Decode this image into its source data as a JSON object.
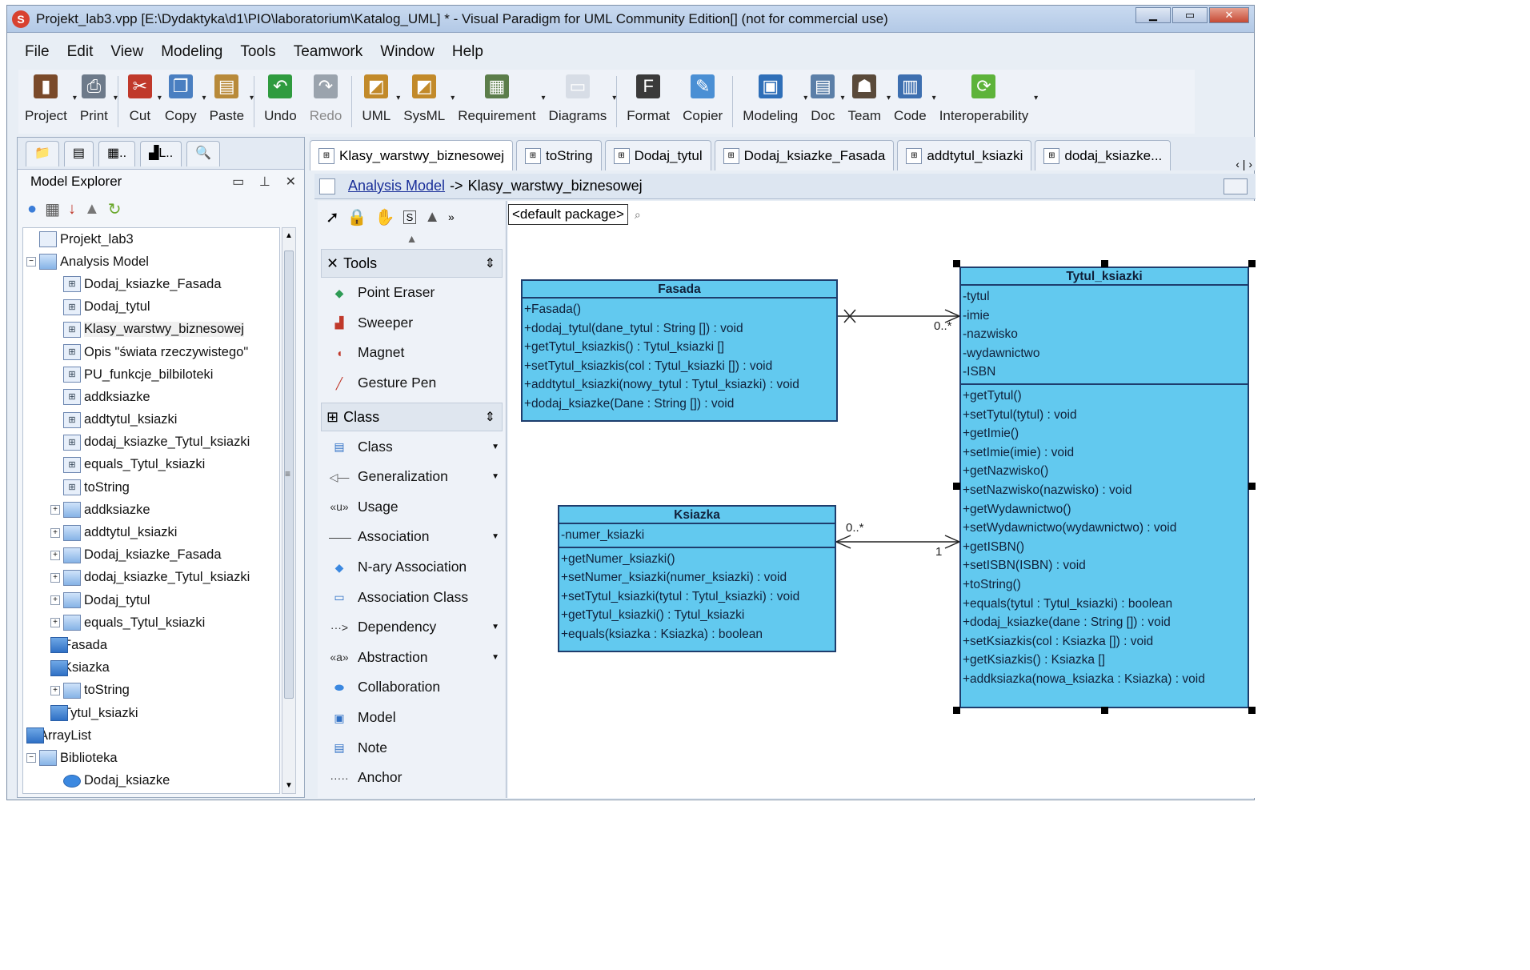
{
  "window": {
    "title": "Projekt_lab3.vpp [E:\\Dydaktyka\\d1\\PIO\\laboratorium\\Katalog_UML] * - Visual Paradigm for UML Community Edition[] (not for commercial use)",
    "minimize": "▁",
    "maximize": "▭",
    "close": "✕"
  },
  "menu": [
    "File",
    "Edit",
    "View",
    "Modeling",
    "Tools",
    "Teamwork",
    "Window",
    "Help"
  ],
  "toolbar": [
    {
      "label": "Project",
      "icon": "project-icon",
      "color": "#7a4a2a"
    },
    {
      "label": "Print",
      "icon": "printer-icon",
      "color": "#6d7a8a"
    },
    {
      "label": "Cut",
      "icon": "scissors-icon",
      "color": "#c0392b"
    },
    {
      "label": "Copy",
      "icon": "copy-icon",
      "color": "#4a7fc1"
    },
    {
      "label": "Paste",
      "icon": "paste-icon",
      "color": "#b88a3a"
    },
    {
      "label": "Undo",
      "icon": "undo-icon",
      "color": "#2f9b3f"
    },
    {
      "label": "Redo",
      "icon": "redo-icon",
      "color": "#9aa3ad",
      "disabled": true
    },
    {
      "label": "UML",
      "icon": "uml-icon",
      "color": "#c28a2a"
    },
    {
      "label": "SysML",
      "icon": "sysml-icon",
      "color": "#c28a2a"
    },
    {
      "label": "Requirement",
      "icon": "requirement-icon",
      "color": "#5b7d4a"
    },
    {
      "label": "Diagrams",
      "icon": "diagrams-icon",
      "color": "#d7dde6"
    },
    {
      "label": "Format",
      "icon": "format-icon",
      "color": "#3a3a3a"
    },
    {
      "label": "Copier",
      "icon": "copier-icon",
      "color": "#4a8fd4"
    },
    {
      "label": "Modeling",
      "icon": "modeling-icon",
      "color": "#2f6fb8"
    },
    {
      "label": "Doc",
      "icon": "doc-icon",
      "color": "#5b7fa8"
    },
    {
      "label": "Team",
      "icon": "team-icon",
      "color": "#5a4a3a"
    },
    {
      "label": "Code",
      "icon": "code-icon",
      "color": "#3d6fb0"
    },
    {
      "label": "Interoperability",
      "icon": "interoperability-icon",
      "color": "#5db33a"
    }
  ],
  "left_panel": {
    "title": "Model Explorer",
    "tabs": [
      "",
      "",
      "..",
      "L..",
      ""
    ],
    "tree": [
      {
        "label": "Projekt_lab3",
        "level": 0,
        "icon": "project-icon",
        "exp": ""
      },
      {
        "label": "Analysis Model",
        "level": 0,
        "icon": "model-icon",
        "exp": "−"
      },
      {
        "label": "Dodaj_ksiazke_Fasada",
        "level": 1,
        "icon": "diagram-icon",
        "exp": ""
      },
      {
        "label": "Dodaj_tytul",
        "level": 1,
        "icon": "diagram-icon",
        "exp": ""
      },
      {
        "label": "Klasy_warstwy_biznesowej",
        "level": 1,
        "icon": "diagram-icon",
        "exp": "",
        "selected": true
      },
      {
        "label": "Opis \"świata rzeczywistego\"",
        "level": 1,
        "icon": "diagram-icon",
        "exp": ""
      },
      {
        "label": "PU_funkcje_bilbiloteki",
        "level": 1,
        "icon": "diagram-icon",
        "exp": ""
      },
      {
        "label": "addksiazke",
        "level": 1,
        "icon": "diagram-icon",
        "exp": ""
      },
      {
        "label": "addtytul_ksiazki",
        "level": 1,
        "icon": "diagram-icon",
        "exp": ""
      },
      {
        "label": "dodaj_ksiazke_Tytul_ksiazki",
        "level": 1,
        "icon": "diagram-icon",
        "exp": ""
      },
      {
        "label": "equals_Tytul_ksiazki",
        "level": 1,
        "icon": "diagram-icon",
        "exp": ""
      },
      {
        "label": "toString",
        "level": 1,
        "icon": "diagram-icon",
        "exp": ""
      },
      {
        "label": "addksiazke",
        "level": 1,
        "icon": "folder-icon",
        "exp": "+"
      },
      {
        "label": "addtytul_ksiazki",
        "level": 1,
        "icon": "folder-icon",
        "exp": "+"
      },
      {
        "label": "Dodaj_ksiazke_Fasada",
        "level": 1,
        "icon": "folder-icon",
        "exp": "+"
      },
      {
        "label": "dodaj_ksiazke_Tytul_ksiazki",
        "level": 1,
        "icon": "folder-icon",
        "exp": "+"
      },
      {
        "label": "Dodaj_tytul",
        "level": 1,
        "icon": "folder-icon",
        "exp": "+"
      },
      {
        "label": "equals_Tytul_ksiazki",
        "level": 1,
        "icon": "folder-icon",
        "exp": "+"
      },
      {
        "label": "Fasada",
        "level": 1,
        "icon": "class-icon",
        "exp": "+"
      },
      {
        "label": "Ksiazka",
        "level": 1,
        "icon": "class-icon",
        "exp": "+"
      },
      {
        "label": "toString",
        "level": 1,
        "icon": "folder-icon",
        "exp": "+"
      },
      {
        "label": "Tytul_ksiazki",
        "level": 1,
        "icon": "class-icon",
        "exp": "+"
      },
      {
        "label": "ArrayList",
        "level": 0,
        "icon": "class-icon",
        "exp": ""
      },
      {
        "label": "Biblioteka",
        "level": 0,
        "icon": "package-icon",
        "exp": "−"
      },
      {
        "label": "Dodaj_ksiazke",
        "level": 1,
        "icon": "usecase-icon",
        "exp": ""
      }
    ]
  },
  "diagram_tabs": [
    {
      "label": "Klasy_warstwy_biznesowej",
      "active": true
    },
    {
      "label": "toString"
    },
    {
      "label": "Dodaj_tytul"
    },
    {
      "label": "Dodaj_ksiazke_Fasada"
    },
    {
      "label": "addtytul_ksiazki"
    },
    {
      "label": "dodaj_ksiazke..."
    }
  ],
  "breadcrumb": {
    "root": "Analysis Model",
    "separator": "->",
    "current": "Klasy_warstwy_biznesowej"
  },
  "palette": {
    "sections": [
      {
        "title": "Tools",
        "items": [
          {
            "label": "Point Eraser",
            "icon": "eraser-icon",
            "glyph": "◆",
            "color": "#2e9b55"
          },
          {
            "label": "Sweeper",
            "icon": "sweeper-icon",
            "glyph": "▟",
            "color": "#c0392b"
          },
          {
            "label": "Magnet",
            "icon": "magnet-icon",
            "glyph": "◖",
            "color": "#c0392b"
          },
          {
            "label": "Gesture Pen",
            "icon": "pen-icon",
            "glyph": "╱",
            "color": "#c0392b"
          }
        ]
      },
      {
        "title": "Class",
        "items": [
          {
            "label": "Class",
            "icon": "class-icon",
            "glyph": "▤",
            "color": "#2f70c5",
            "arrow": true
          },
          {
            "label": "Generalization",
            "icon": "generalization-icon",
            "glyph": "◁—",
            "color": "#555",
            "arrow": true
          },
          {
            "label": "Usage",
            "icon": "usage-icon",
            "glyph": "«u»",
            "color": "#333",
            "arrow": false
          },
          {
            "label": "Association",
            "icon": "association-icon",
            "glyph": "——",
            "color": "#333",
            "arrow": true
          },
          {
            "label": "N-ary Association",
            "icon": "nary-association-icon",
            "glyph": "◆",
            "color": "#3b88e0",
            "arrow": false
          },
          {
            "label": "Association Class",
            "icon": "association-class-icon",
            "glyph": "▭",
            "color": "#2f70c5",
            "arrow": false
          },
          {
            "label": "Dependency",
            "icon": "dependency-icon",
            "glyph": "···>",
            "color": "#333",
            "arrow": true
          },
          {
            "label": "Abstraction",
            "icon": "abstraction-icon",
            "glyph": "«a»",
            "color": "#333",
            "arrow": true
          },
          {
            "label": "Collaboration",
            "icon": "collaboration-icon",
            "glyph": "⬬",
            "color": "#3b88e0",
            "arrow": false
          },
          {
            "label": "Model",
            "icon": "model-icon",
            "glyph": "▣",
            "color": "#2f70c5",
            "arrow": false
          },
          {
            "label": "Note",
            "icon": "note-icon",
            "glyph": "▤",
            "color": "#2f70c5",
            "arrow": false
          },
          {
            "label": "Anchor",
            "icon": "anchor-icon",
            "glyph": "·····",
            "color": "#333",
            "arrow": false
          }
        ]
      }
    ]
  },
  "package": "<default package>",
  "classes": {
    "fasada": {
      "name": "Fasada",
      "attributes": [],
      "operations": [
        "+Fasada()",
        "+dodaj_tytul(dane_tytul : String []) : void",
        "+getTytul_ksiazkis() : Tytul_ksiazki []",
        "+setTytul_ksiazkis(col : Tytul_ksiazki []) : void",
        "+addtytul_ksiazki(nowy_tytul : Tytul_ksiazki) : void",
        "+dodaj_ksiazke(Dane : String []) : void"
      ]
    },
    "ksiazka": {
      "name": "Ksiazka",
      "attributes": [
        "-numer_ksiazki"
      ],
      "operations": [
        "+getNumer_ksiazki()",
        "+setNumer_ksiazki(numer_ksiazki) : void",
        "+setTytul_ksiazki(tytul : Tytul_ksiazki) : void",
        "+getTytul_ksiazki() : Tytul_ksiazki",
        "+equals(ksiazka : Ksiazka) : boolean"
      ]
    },
    "tytul": {
      "name": "Tytul_ksiazki",
      "attributes": [
        "-tytul",
        "-imie",
        "-nazwisko",
        "-wydawnictwo",
        "-ISBN"
      ],
      "operations": [
        "+getTytul()",
        "+setTytul(tytul) : void",
        "+getImie()",
        "+setImie(imie) : void",
        "+getNazwisko()",
        "+setNazwisko(nazwisko) : void",
        "+getWydawnictwo()",
        "+setWydawnictwo(wydawnictwo) : void",
        "+getISBN()",
        "+setISBN(ISBN) : void",
        "+toString()",
        "+equals(tytul : Tytul_ksiazki) : boolean",
        "+dodaj_ksiazke(dane : String []) : void",
        "+setKsiazkis(col : Ksiazka []) : void",
        "+getKsiazkis() : Ksiazka []",
        "+addksiazka(nowa_ksiazka : Ksiazka) : void"
      ]
    }
  },
  "associations": [
    {
      "from": "Fasada",
      "to": "Tytul_ksiazki",
      "target_multiplicity": "0..*"
    },
    {
      "from": "Ksiazka",
      "to": "Tytul_ksiazki",
      "source_multiplicity": "0..*",
      "target_multiplicity": "1"
    }
  ],
  "colors": {
    "class_fill": "#62c9ef",
    "class_border": "#1e3d6d"
  }
}
